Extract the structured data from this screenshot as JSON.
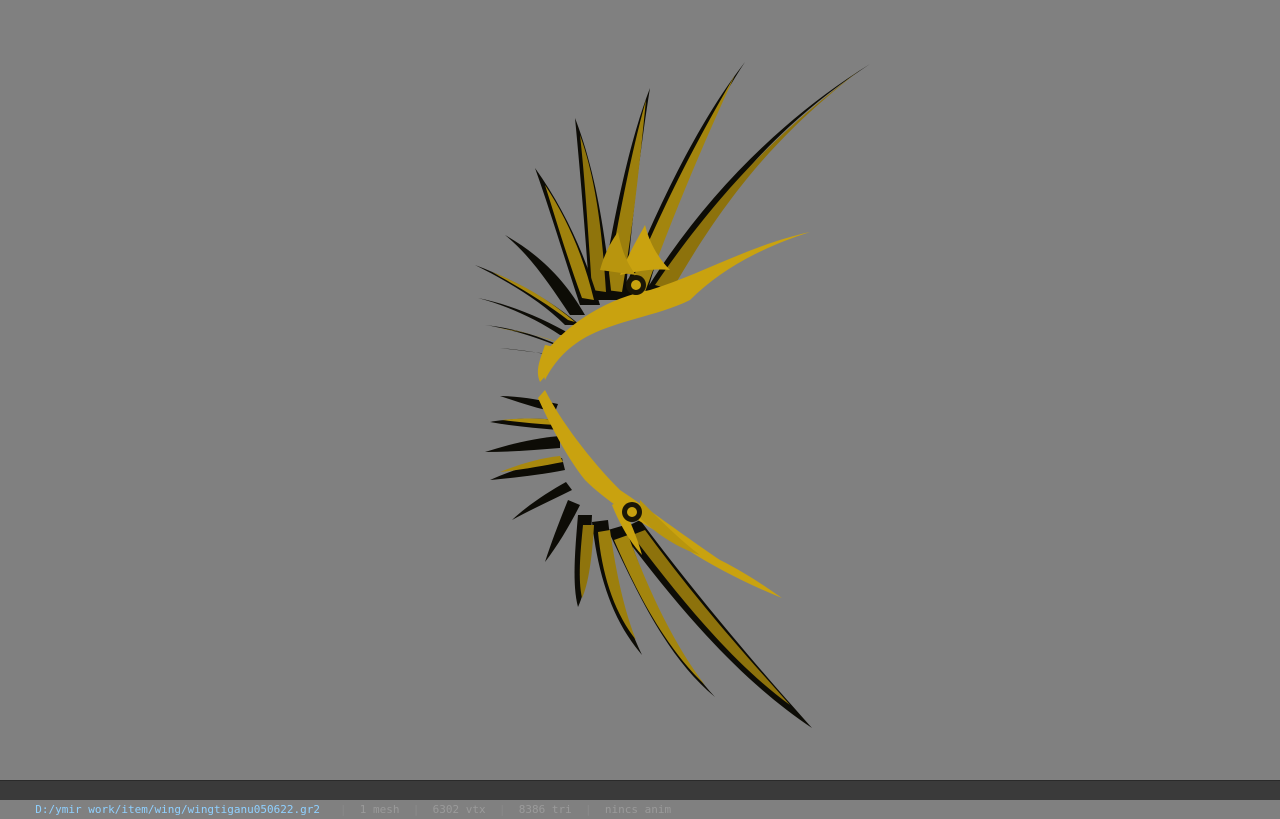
{
  "viewer": {
    "background": "#808080",
    "model_colors": {
      "gold": "#c9a20f",
      "dark": "#111008"
    }
  },
  "status": {
    "path": "D:/ymir work/item/wing/wingtiganu050622.gr2",
    "separator": "|",
    "mesh": "1 mesh",
    "vtx": "6302 vtx",
    "tri": "8386 tri",
    "anim": "nincs anim"
  }
}
